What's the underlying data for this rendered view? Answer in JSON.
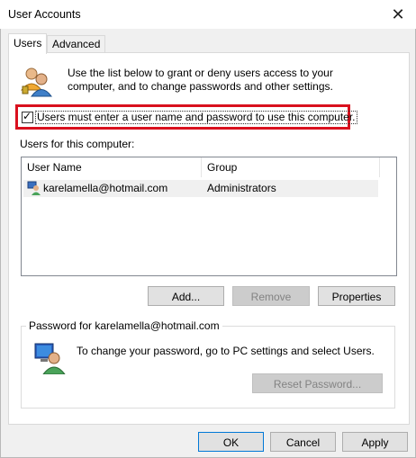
{
  "window": {
    "title": "User Accounts",
    "close_glyph": "✕"
  },
  "tabs": [
    {
      "label": "Users",
      "active": true
    },
    {
      "label": "Advanced",
      "active": false
    }
  ],
  "users_tab": {
    "intro": "Use the list below to grant or deny users access to your computer, and to change passwords and other settings.",
    "must_login_checkbox": {
      "label": "Users must enter a user name and password to use this computer.",
      "checked": true,
      "check_glyph": "✓"
    },
    "highlight_color": "#d9101e",
    "users_list_label": "Users for this computer:",
    "columns": [
      "User Name",
      "Group"
    ],
    "rows": [
      {
        "user": "karelamella@hotmail.com",
        "group": "Administrators"
      }
    ],
    "buttons": {
      "add": "Add...",
      "remove": "Remove",
      "properties": "Properties"
    },
    "password_group": {
      "legend": "Password for karelamella@hotmail.com",
      "text": "To change your password, go to PC settings and select Users.",
      "reset_button": "Reset Password..."
    }
  },
  "footer": {
    "ok": "OK",
    "cancel": "Cancel",
    "apply": "Apply"
  },
  "icons": {
    "users": "users-icon",
    "user_row": "user-icon",
    "password": "password-computer-icon"
  },
  "colors": {
    "accent": "#0078d7",
    "disabled_text": "#838383"
  }
}
